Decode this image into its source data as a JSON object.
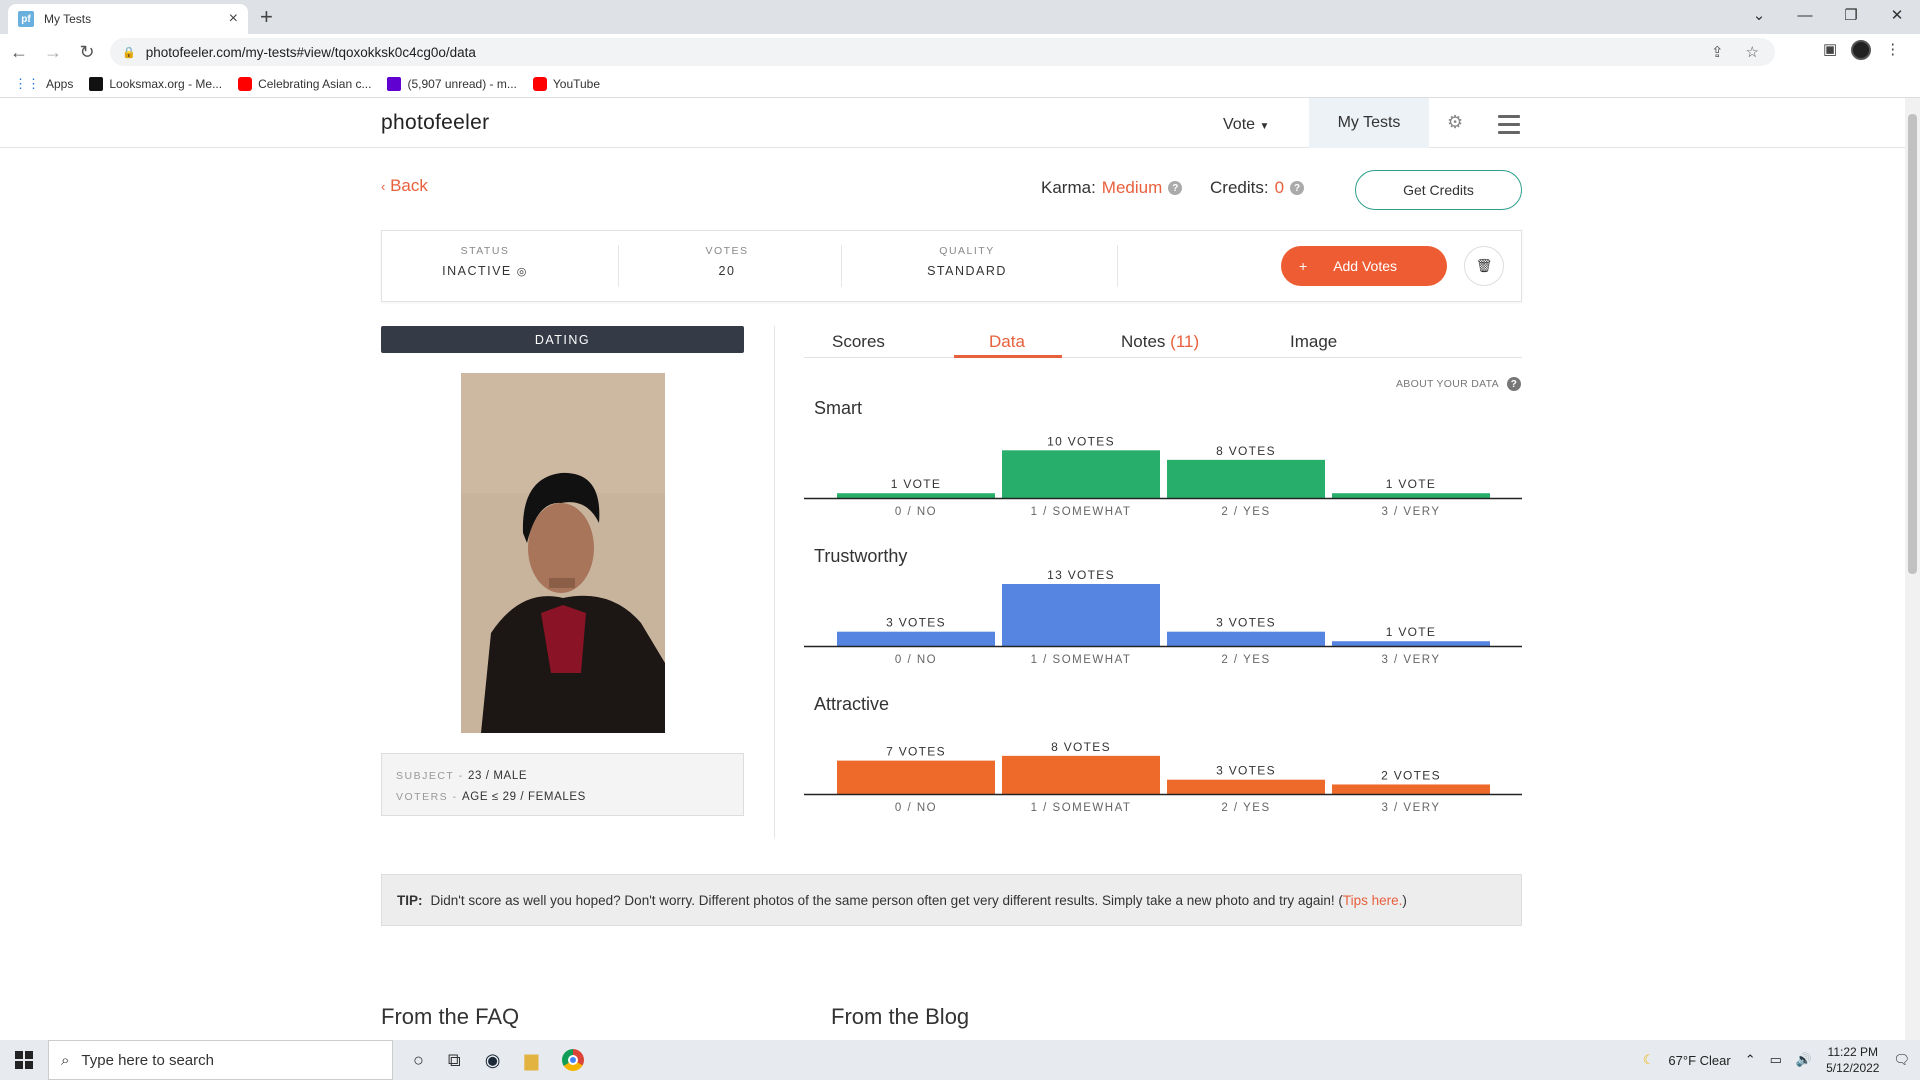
{
  "browser": {
    "tab_title": "My Tests",
    "tab_favicon": "pf",
    "url": "photofeeler.com/my-tests#view/tqoxokksk0c4cg0o/data",
    "bookmarks": [
      {
        "label": "Apps",
        "icon": "apps-grid-icon",
        "color": "#1a73e8"
      },
      {
        "label": "Looksmax.org - Me...",
        "icon": "looksmax-icon",
        "color": "#111111"
      },
      {
        "label": "Celebrating Asian c...",
        "icon": "youtube-icon",
        "color": "#ff0000"
      },
      {
        "label": "(5,907 unread) - m...",
        "icon": "yahoo-mail-icon",
        "color": "#6001d2"
      },
      {
        "label": "YouTube",
        "icon": "youtube-icon",
        "color": "#ff0000"
      }
    ]
  },
  "header": {
    "logo": "photofeeler",
    "nav_vote": "Vote",
    "nav_my_tests": "My Tests"
  },
  "account": {
    "back_label": "Back",
    "karma_label": "Karma:",
    "karma_value": "Medium",
    "credits_label": "Credits:",
    "credits_value": "0",
    "get_credits": "Get Credits"
  },
  "status_bar": {
    "status_label": "STATUS",
    "status_value": "INACTIVE",
    "votes_label": "VOTES",
    "votes_value": "20",
    "quality_label": "QUALITY",
    "quality_value": "STANDARD",
    "add_votes": "Add Votes",
    "add_votes_plus": "+"
  },
  "photo_panel": {
    "category": "DATING",
    "subject_key": "SUBJECT",
    "subject_value": "23 / MALE",
    "voters_key": "VOTERS",
    "voters_value": "AGE ≤ 29 / FEMALES"
  },
  "tabs": [
    {
      "label": "Scores",
      "active": false
    },
    {
      "label": "Data",
      "active": true
    },
    {
      "label": "Notes",
      "count": "(11)",
      "active": false
    },
    {
      "label": "Image",
      "active": false
    }
  ],
  "about_data": "ABOUT YOUR DATA",
  "chart_data": [
    {
      "type": "bar",
      "title": "Smart",
      "color": "#27ae6b",
      "categories": [
        "0 / NO",
        "1 / SOMEWHAT",
        "2 / YES",
        "3 / VERY"
      ],
      "values": [
        1,
        10,
        8,
        1
      ],
      "data_labels": [
        "1 VOTE",
        "10 VOTES",
        "8 VOTES",
        "1 VOTE"
      ]
    },
    {
      "type": "bar",
      "title": "Trustworthy",
      "color": "#5585e0",
      "categories": [
        "0 / NO",
        "1 / SOMEWHAT",
        "2 / YES",
        "3 / VERY"
      ],
      "values": [
        3,
        13,
        3,
        1
      ],
      "data_labels": [
        "3 VOTES",
        "13 VOTES",
        "3 VOTES",
        "1 VOTE"
      ]
    },
    {
      "type": "bar",
      "title": "Attractive",
      "color": "#ee6a2b",
      "categories": [
        "0 / NO",
        "1 / SOMEWHAT",
        "2 / YES",
        "3 / VERY"
      ],
      "values": [
        7,
        8,
        3,
        2
      ],
      "data_labels": [
        "7 VOTES",
        "8 VOTES",
        "3 VOTES",
        "2 VOTES"
      ]
    }
  ],
  "tip": {
    "label": "TIP:",
    "text": "Didn't score as well you hoped? Don't worry. Different photos of the same person often get very different results. Simply take a new photo and try again! (",
    "link": "Tips here.",
    "close": ")"
  },
  "sections": {
    "faq": "From the FAQ",
    "blog": "From the Blog"
  },
  "taskbar": {
    "search_placeholder": "Type here to search",
    "weather": "67°F  Clear",
    "time": "11:22 PM",
    "date": "5/12/2022"
  }
}
